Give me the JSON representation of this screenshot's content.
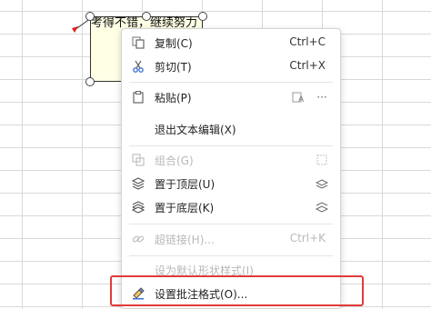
{
  "comment": {
    "text": "考得不错，继续努力"
  },
  "menu": {
    "items": [
      {
        "label": "复制(C)",
        "shortcut": "Ctrl+C",
        "icon": "copy-icon",
        "disabled": false
      },
      {
        "label": "剪切(T)",
        "shortcut": "Ctrl+X",
        "icon": "scissors-icon",
        "disabled": false
      },
      {
        "label": "粘贴(P)",
        "shortcut": "",
        "icon": "paste-icon",
        "disabled": false
      },
      {
        "label": "退出文本编辑(X)",
        "shortcut": "",
        "icon": "",
        "disabled": false
      },
      {
        "label": "组合(G)",
        "shortcut": "",
        "icon": "group-icon",
        "disabled": true
      },
      {
        "label": "置于顶层(U)",
        "shortcut": "",
        "icon": "bring-to-front-icon",
        "disabled": false
      },
      {
        "label": "置于底层(K)",
        "shortcut": "",
        "icon": "send-to-back-icon",
        "disabled": false
      },
      {
        "label": "超链接(H)...",
        "shortcut": "Ctrl+K",
        "icon": "link-icon",
        "disabled": true
      },
      {
        "label": "设为默认形状样式(I)",
        "shortcut": "",
        "icon": "",
        "disabled": true
      },
      {
        "label": "设置批注格式(O)...",
        "shortcut": "",
        "icon": "format-comment-icon",
        "disabled": false
      }
    ],
    "paste_more": "···"
  },
  "colors": {
    "highlight": "#e23a3a",
    "comment_bg": "#ffffe6"
  }
}
